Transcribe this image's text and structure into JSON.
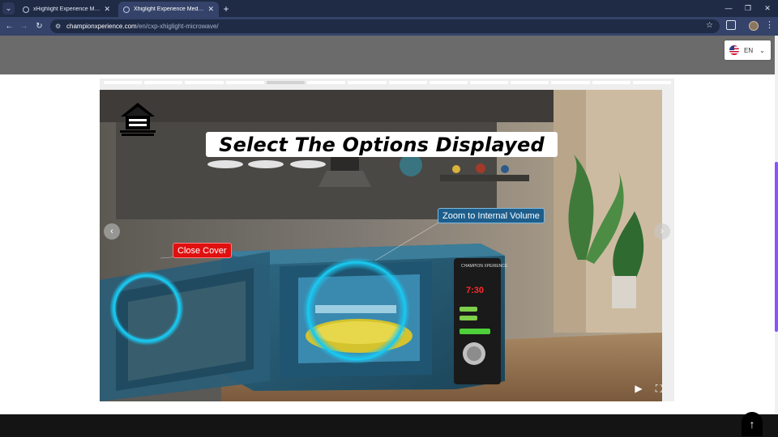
{
  "browser": {
    "tabs": [
      {
        "title": "xHighlight Experience Media - CX",
        "active": false
      },
      {
        "title": "Xhiglight Experience Media - Mic",
        "active": true
      }
    ],
    "url_host": "championxperience.com",
    "url_path": "/en/cxp-xhiglight-microwave/"
  },
  "language": {
    "code": "EN"
  },
  "scene": {
    "title": "Select The Options Displayed",
    "hotspots": {
      "zoom_label": "Zoom to Internal Volume",
      "close_label": "Close Cover"
    },
    "panel_brand": "CHAMPION XPERIENCE",
    "panel_display": "7:30"
  },
  "icons": {
    "home": "home-icon",
    "play": "play-icon",
    "fullscreen": "fullscreen-icon",
    "prev": "chevron-left-icon",
    "next": "chevron-right-icon",
    "back_to_top": "arrow-up-icon"
  },
  "colors": {
    "header_gray": "#6b6b6b",
    "accent_purple": "#8c52ff",
    "hotspot_cyan": "#19c8f0",
    "close_red": "#e01010",
    "zoom_blue": "#1d5e8c"
  }
}
